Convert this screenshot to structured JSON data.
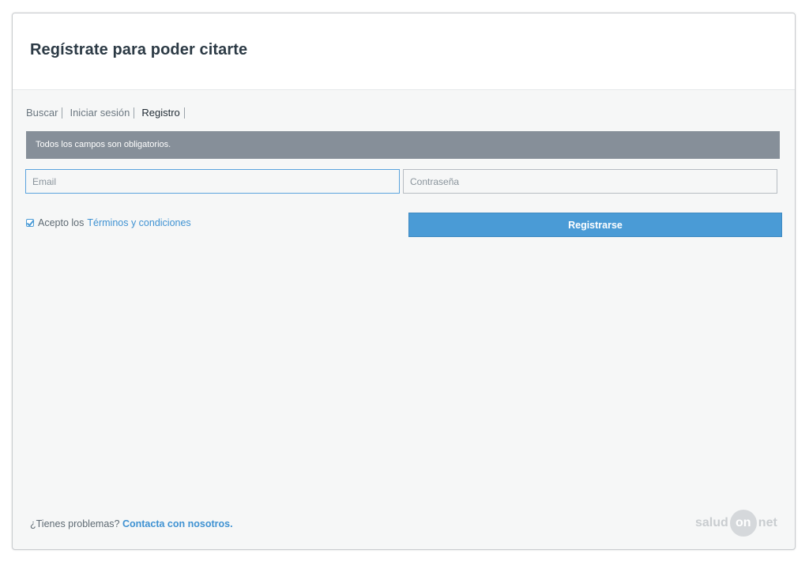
{
  "dialog": {
    "title": "Regístrate para poder citarte"
  },
  "tabs": [
    {
      "label": "Buscar"
    },
    {
      "label": "Iniciar sesión"
    },
    {
      "label": "Registro"
    }
  ],
  "notice": "Todos los campos son obligatorios.",
  "form": {
    "email_placeholder": "Email",
    "email_value": "",
    "password_placeholder": "Contraseña",
    "password_value": "",
    "terms_checked": true,
    "terms_prefix": "Acepto los",
    "terms_link": "Términos y condiciones",
    "submit_label": "Registrarse"
  },
  "footer": {
    "text": "¿Tienes problemas?",
    "link": "Contacta con nosotros."
  },
  "logo": {
    "part1": "salud",
    "part2": "on",
    "part3": "net"
  },
  "colors": {
    "accent": "#4a9bd6",
    "notice_bg": "#868f99",
    "title": "#2c3a45"
  }
}
